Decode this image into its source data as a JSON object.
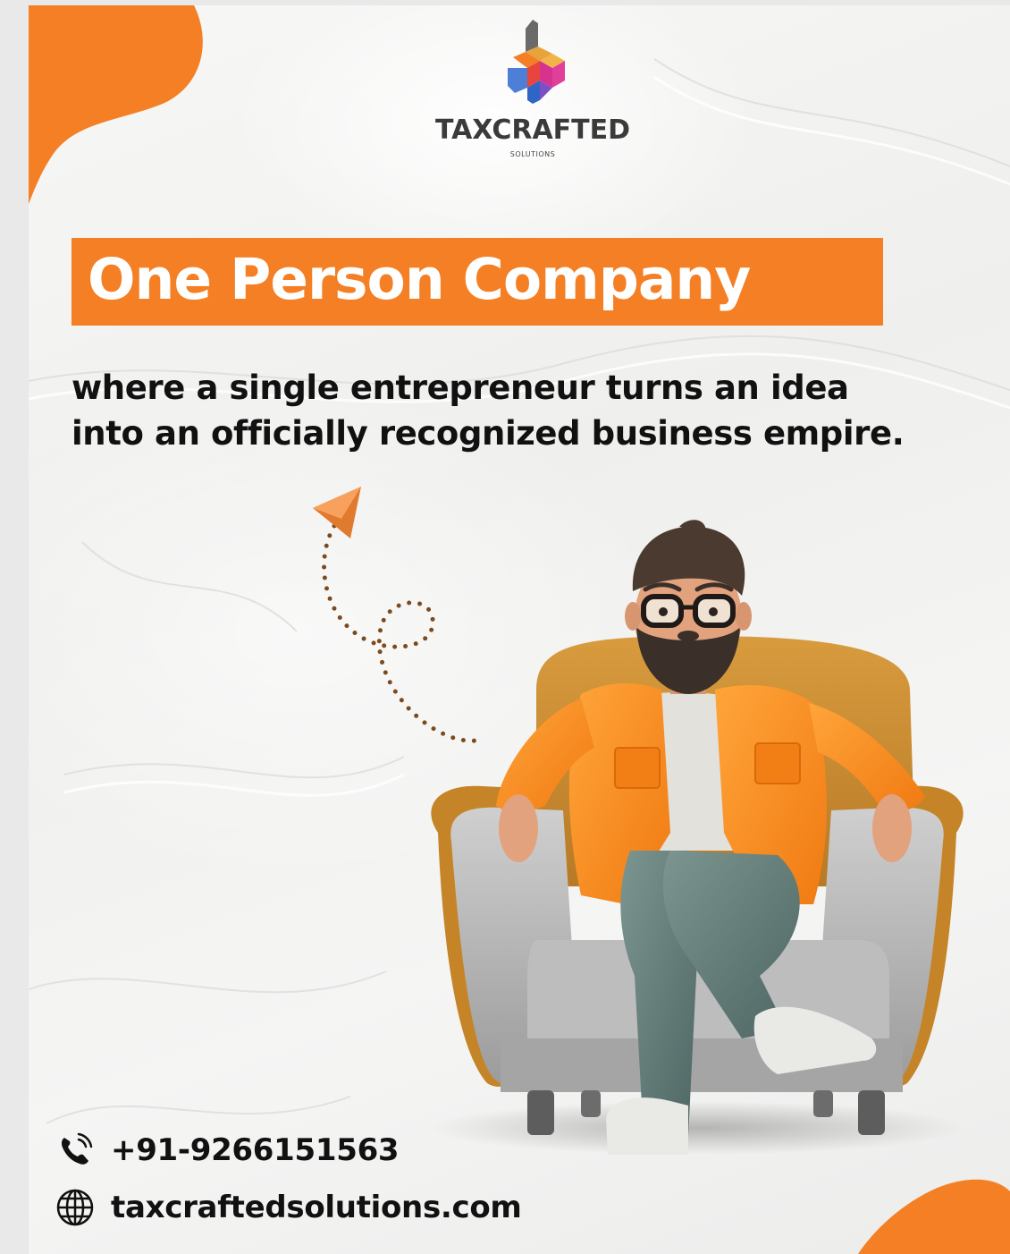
{
  "brand": {
    "name": "TAXCRAFTED",
    "tagline": "SOLUTIONS",
    "accent_color": "#f47f24"
  },
  "headline": "One Person Company",
  "description": "where a single entrepreneur turns an idea into an officially recognized business empire.",
  "contact": {
    "phone_icon": "phone-icon",
    "phone": "+91-9266151563",
    "web_icon": "globe-icon",
    "website": "taxcraftedsolutions.com"
  },
  "illustration": {
    "subject": "bearded-man-in-armchair",
    "arrow": "dotted-curl-arrow"
  }
}
